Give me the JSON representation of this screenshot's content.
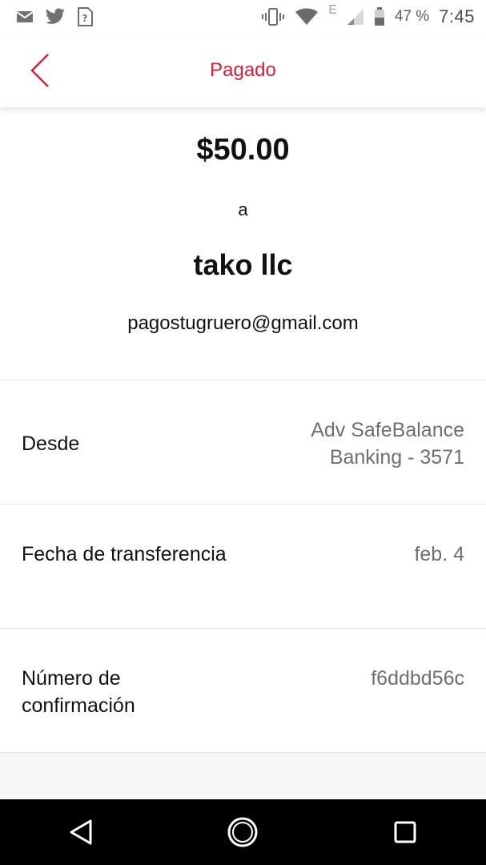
{
  "status_bar": {
    "battery_percent": "47 %",
    "time": "7:45",
    "network_type": "E",
    "icons": [
      "mail-icon",
      "twitter-icon",
      "sim-unknown-icon",
      "vibrate-icon",
      "wifi-icon",
      "signal-icon",
      "battery-icon"
    ]
  },
  "header": {
    "title": "Pagado",
    "back_icon": "chevron-left-icon"
  },
  "payment": {
    "amount": "$50.00",
    "to_word": "a",
    "recipient_name": "tako llc",
    "recipient_email": "pagostugruero@gmail.com"
  },
  "details": [
    {
      "label": "Desde",
      "value": "Adv SafeBalance Banking - 3571"
    },
    {
      "label": "Fecha de transferencia",
      "value": "feb. 4"
    },
    {
      "label": "Número de confirmación",
      "value": "f6ddbd56c"
    }
  ],
  "colors": {
    "accent": "#d41e39",
    "value_gray": "#6f6f6f",
    "nav_bar": "#000000"
  },
  "nav": {
    "icons": [
      "back-triangle-icon",
      "home-circle-icon",
      "recents-square-icon"
    ]
  }
}
